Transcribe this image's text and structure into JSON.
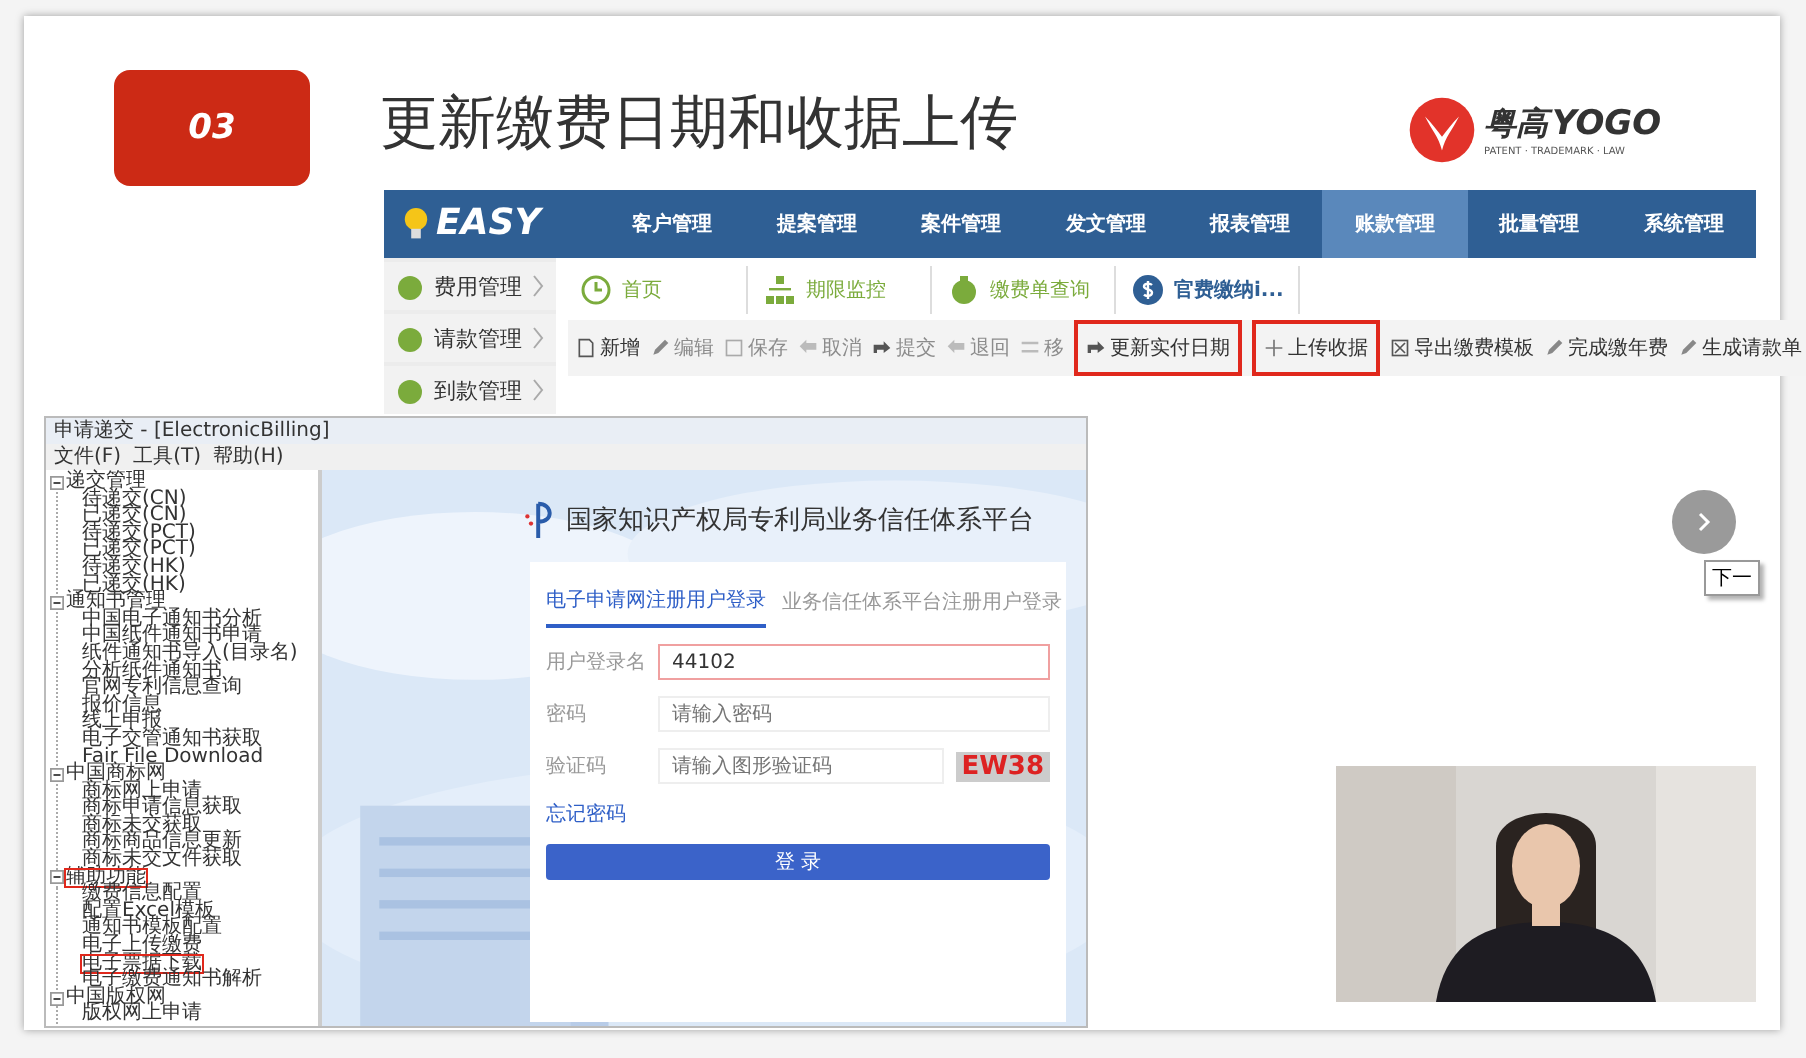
{
  "slide": {
    "number": "03",
    "title": "更新缴费日期和收据上传"
  },
  "logo": {
    "name": "粤高",
    "latin": "YOGO",
    "tagline": "PATENT · TRADEMARK · LAW"
  },
  "easy_app": {
    "logo": "EASY",
    "nav": [
      {
        "label": "客户管理",
        "selected": false
      },
      {
        "label": "提案管理",
        "selected": false
      },
      {
        "label": "案件管理",
        "selected": false
      },
      {
        "label": "发文管理",
        "selected": false
      },
      {
        "label": "报表管理",
        "selected": false
      },
      {
        "label": "账款管理",
        "selected": true
      },
      {
        "label": "批量管理",
        "selected": false
      },
      {
        "label": "系统管理",
        "selected": false
      }
    ],
    "sidebar": [
      "费用管理",
      "请款管理",
      "到款管理"
    ],
    "tabs": [
      "首页",
      "期限监控",
      "缴费单查询",
      "官费缴纳i..."
    ],
    "toolbar": [
      {
        "label": "新增",
        "disabled": false,
        "highlighted": false
      },
      {
        "label": "编辑",
        "disabled": true,
        "highlighted": false
      },
      {
        "label": "保存",
        "disabled": true,
        "highlighted": false
      },
      {
        "label": "取消",
        "disabled": true,
        "highlighted": false
      },
      {
        "label": "提交",
        "disabled": true,
        "highlighted": false
      },
      {
        "label": "退回",
        "disabled": true,
        "highlighted": false
      },
      {
        "label": "移",
        "disabled": true,
        "highlighted": false
      },
      {
        "label": "更新实付日期",
        "disabled": false,
        "highlighted": true
      },
      {
        "label": "上传收据",
        "disabled": false,
        "highlighted": true
      },
      {
        "label": "导出缴费模板",
        "disabled": false,
        "highlighted": false
      },
      {
        "label": "完成缴年费",
        "disabled": false,
        "highlighted": false
      },
      {
        "label": "生成请款单",
        "disabled": false,
        "highlighted": false
      }
    ]
  },
  "legacy_window": {
    "title": "申请递交 - [ElectronicBilling]",
    "menu": [
      "文件(F)",
      "工具(T)",
      "帮助(H)"
    ],
    "tree": [
      {
        "label": "递交管理",
        "expanded": true,
        "highlighted": false,
        "children": [
          {
            "label": "待递交(CN)",
            "highlighted": false
          },
          {
            "label": "已递交(CN)",
            "highlighted": false
          },
          {
            "label": "待递交(PCT)",
            "highlighted": false
          },
          {
            "label": "已递交(PCT)",
            "highlighted": false
          },
          {
            "label": "待递交(HK)",
            "highlighted": false
          },
          {
            "label": "已递交(HK)",
            "highlighted": false
          }
        ]
      },
      {
        "label": "通知书管理",
        "expanded": true,
        "highlighted": false,
        "children": [
          {
            "label": "中国电子通知书分析",
            "highlighted": false
          },
          {
            "label": "中国纸件通知书申请",
            "highlighted": false
          },
          {
            "label": "纸件通知书导入(目录名)",
            "highlighted": false
          },
          {
            "label": "分析纸件通知书",
            "highlighted": false
          },
          {
            "label": "官网专利信息查询",
            "highlighted": false
          },
          {
            "label": "报价信息",
            "highlighted": false
          },
          {
            "label": "线上申报",
            "highlighted": false
          },
          {
            "label": "电子交管通知书获取",
            "highlighted": false
          },
          {
            "label": "Fair File Download",
            "highlighted": false
          }
        ]
      },
      {
        "label": "中国商标网",
        "expanded": true,
        "highlighted": false,
        "children": [
          {
            "label": "商标网上申请",
            "highlighted": false
          },
          {
            "label": "商标申请信息获取",
            "highlighted": false
          },
          {
            "label": "商标未交获取",
            "highlighted": false
          },
          {
            "label": "商标商品信息更新",
            "highlighted": false
          },
          {
            "label": "商标未交文件获取",
            "highlighted": false
          }
        ]
      },
      {
        "label": "辅助功能",
        "expanded": true,
        "highlighted": true,
        "children": [
          {
            "label": "缴费信息配置",
            "highlighted": false
          },
          {
            "label": "配置Excel模板",
            "highlighted": false
          },
          {
            "label": "通知书模板配置",
            "highlighted": false
          },
          {
            "label": "电子上传缴费",
            "highlighted": false
          },
          {
            "label": "电子票据下载",
            "highlighted": true
          },
          {
            "label": "电子缴费通知书解析",
            "highlighted": false
          }
        ]
      },
      {
        "label": "中国版权网",
        "expanded": true,
        "highlighted": false,
        "children": [
          {
            "label": "版权网上申请",
            "highlighted": false
          }
        ]
      }
    ]
  },
  "login": {
    "platform": "国家知识产权局专利局业务信任体系平台",
    "tabs": [
      {
        "label": "电子申请网注册用户登录",
        "selected": true
      },
      {
        "label": "业务信任体系平台注册用户登录",
        "selected": false
      }
    ],
    "fields": [
      {
        "label": "用户登录名",
        "value": "44102",
        "focused": true
      },
      {
        "label": "密码",
        "placeholder": "请输入密码",
        "focused": false
      },
      {
        "label": "验证码",
        "placeholder": "请输入图形验证码",
        "focused": false
      }
    ],
    "captcha": "EW38",
    "forgot_link": "忘记密码",
    "submit": "登 录"
  },
  "next_tooltip": "下一"
}
